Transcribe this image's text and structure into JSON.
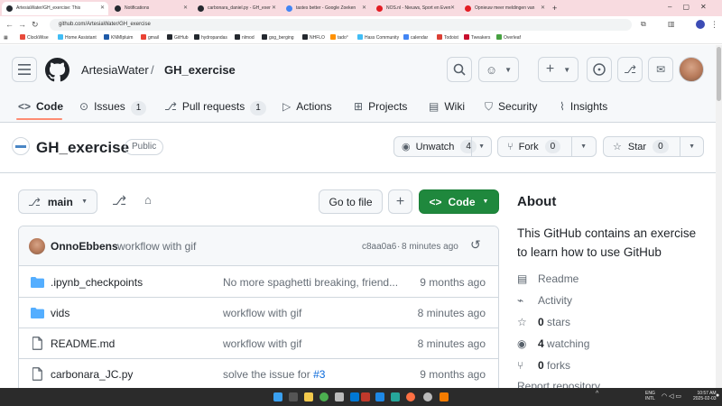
{
  "browser": {
    "tabs": [
      {
        "title": "ArtesiaWater/GH_exercise: This",
        "active": true
      },
      {
        "title": "Notifications",
        "active": false
      },
      {
        "title": "carbonara_daniel.py - GH_exer",
        "active": false
      },
      {
        "title": "tastes better - Google Zoeken",
        "active": false
      },
      {
        "title": "NOS.nl - Nieuws, Sport en Even",
        "active": false
      },
      {
        "title": "Opnieuw meer meldingen van",
        "active": false
      }
    ],
    "new_tab": "+",
    "url": "github.com/ArtesiaWater/GH_exercise",
    "bookmarks": [
      "ClockWise",
      "Home Assistant",
      "KNMIpluim",
      "gmail",
      "GitHub",
      "hydropandas",
      "nlmod",
      "gxg_berging",
      "NHFLO",
      "tado°",
      "Hass Community",
      "calendar",
      "Todoist",
      "Tweakers",
      "Overleaf"
    ]
  },
  "header": {
    "owner": "ArtesiaWater",
    "separator": "/",
    "repo": "GH_exercise",
    "tabs": [
      {
        "label": "Code",
        "count": null,
        "icon": "code-icon"
      },
      {
        "label": "Issues",
        "count": "1",
        "icon": "issue-icon"
      },
      {
        "label": "Pull requests",
        "count": "1",
        "icon": "pull-request-icon"
      },
      {
        "label": "Actions",
        "count": null,
        "icon": "play-icon"
      },
      {
        "label": "Projects",
        "count": null,
        "icon": "table-icon"
      },
      {
        "label": "Wiki",
        "count": null,
        "icon": "book-icon"
      },
      {
        "label": "Security",
        "count": null,
        "icon": "shield-icon"
      },
      {
        "label": "Insights",
        "count": null,
        "icon": "graph-icon"
      }
    ]
  },
  "repo": {
    "title": "GH_exercise",
    "visibility": "Public",
    "unwatch_label": "Unwatch",
    "watch_count": "4",
    "fork_label": "Fork",
    "fork_count": "0",
    "star_label": "Star",
    "star_count": "0"
  },
  "toolbar": {
    "branch": "main",
    "go_to_file": "Go to file",
    "add": "+",
    "code_button": "Code"
  },
  "commit": {
    "author": "OnnoEbbens",
    "message": "workflow with gif",
    "hash": "c8aa0a6",
    "separator": "·",
    "time": "8 minutes ago"
  },
  "files": [
    {
      "name": ".ipynb_checkpoints",
      "type": "folder",
      "message": "No more spaghetti breaking, friend...",
      "time": "9 months ago"
    },
    {
      "name": "vids",
      "type": "folder",
      "message": "workflow with gif",
      "time": "8 minutes ago"
    },
    {
      "name": "README.md",
      "type": "file",
      "message": "workflow with gif",
      "time": "8 minutes ago"
    },
    {
      "name": "carbonara_JC.py",
      "type": "file",
      "message": "solve the issue for ",
      "link": "#3",
      "time": "9 months ago"
    }
  ],
  "about": {
    "heading": "About",
    "description": "This GitHub contains an exercise to learn how to use GitHub",
    "readme": "Readme",
    "activity": "Activity",
    "stars_count": "0",
    "stars_label": "stars",
    "watching_count": "4",
    "watching_label": "watching",
    "forks_count": "0",
    "forks_label": "forks",
    "report": "Report repository"
  },
  "taskbar": {
    "lang1": "ENG",
    "lang2": "INTL",
    "time": "10:57 AM",
    "date": "2025-02-03"
  },
  "colors": {
    "accent": "#1f883d",
    "underline": "#fd8c73",
    "link": "#0969da",
    "folder": "#54aeff"
  }
}
